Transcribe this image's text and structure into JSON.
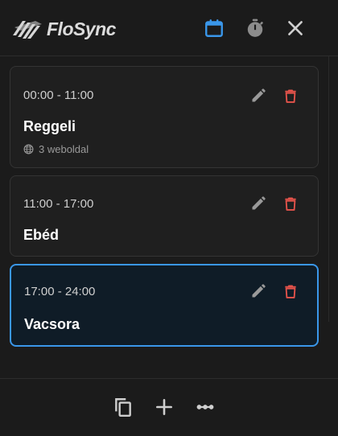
{
  "app": {
    "name": "FloSync"
  },
  "header_icons": {
    "calendar": "calendar-icon",
    "timer": "timer-icon",
    "close": "close-icon"
  },
  "colors": {
    "accent": "#3a97ea",
    "delete": "#e5534b",
    "background": "#1b1b1b",
    "card": "#1f1f1f",
    "active_card": "#0f1c27"
  },
  "schedule": [
    {
      "time": "00:00 - 11:00",
      "title": "Reggeli",
      "sites": "3 weboldal",
      "active": false
    },
    {
      "time": "11:00 - 17:00",
      "title": "Ebéd",
      "sites": "",
      "active": false
    },
    {
      "time": "17:00 - 24:00",
      "title": "Vacsora",
      "sites": "",
      "active": true
    }
  ],
  "footer_icons": {
    "copy": "copy-icon",
    "add": "plus-icon",
    "more": "more-icon"
  }
}
